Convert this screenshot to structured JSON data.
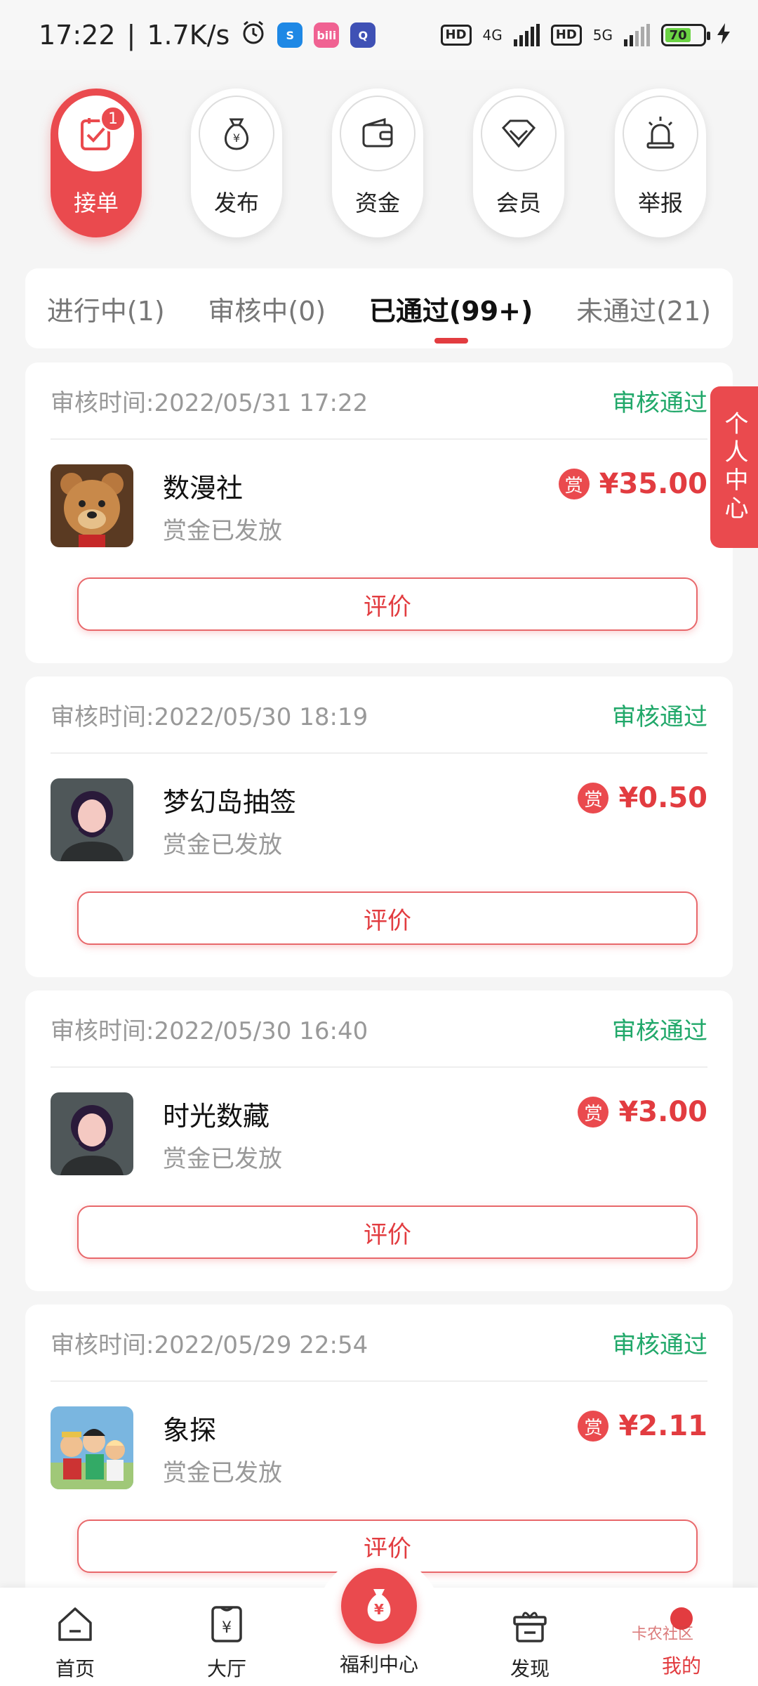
{
  "status_bar": {
    "time": "17:22",
    "speed": "1.7K/s",
    "network1": "4G",
    "network2": "5G",
    "hd1": "HD",
    "hd2": "HD",
    "battery": "70",
    "apps": [
      "alarm-icon",
      "shazam-icon",
      "bilibili-icon",
      "qq-icon"
    ]
  },
  "top_nav": [
    {
      "label": "接单",
      "icon": "task-check-icon",
      "badge": "1",
      "active": true
    },
    {
      "label": "发布",
      "icon": "money-bag-icon"
    },
    {
      "label": "资金",
      "icon": "wallet-icon"
    },
    {
      "label": "会员",
      "icon": "diamond-icon"
    },
    {
      "label": "举报",
      "icon": "alarm-light-icon"
    }
  ],
  "tabs": [
    {
      "label": "进行中(1)"
    },
    {
      "label": "审核中(0)"
    },
    {
      "label": "已通过(99+)",
      "active": true
    },
    {
      "label": "未通过(21)"
    }
  ],
  "side_button": {
    "label": "个人中心"
  },
  "orders": [
    {
      "time": "审核时间:2022/05/31 17:22",
      "status": "审核通过",
      "name": "数漫社",
      "sub": "赏金已发放",
      "reward_icon": "赏",
      "amount": "¥35.00",
      "button": "评价",
      "thumb": "teddy-bear-avatar"
    },
    {
      "time": "审核时间:2022/05/30 18:19",
      "status": "审核通过",
      "name": "梦幻岛抽签",
      "sub": "赏金已发放",
      "reward_icon": "赏",
      "amount": "¥0.50",
      "button": "评价",
      "thumb": "default-person-avatar"
    },
    {
      "time": "审核时间:2022/05/30 16:40",
      "status": "审核通过",
      "name": "时光数藏",
      "sub": "赏金已发放",
      "reward_icon": "赏",
      "amount": "¥3.00",
      "button": "评价",
      "thumb": "default-person-avatar"
    },
    {
      "time": "审核时间:2022/05/29 22:54",
      "status": "审核通过",
      "name": "象探",
      "sub": "赏金已发放",
      "reward_icon": "赏",
      "amount": "¥2.11",
      "button": "评价",
      "thumb": "anime-group-avatar"
    }
  ],
  "bottom_nav": [
    {
      "label": "首页",
      "icon": "home-icon"
    },
    {
      "label": "大厅",
      "icon": "hall-icon"
    },
    {
      "label": "福利中心",
      "icon": "money-bag-icon"
    },
    {
      "label": "发现",
      "icon": "gift-box-icon"
    },
    {
      "label": "我的",
      "icon": "profile-dot-icon",
      "active": true
    }
  ],
  "watermark": "卡农社区",
  "colors": {
    "accent": "#ea4a4e",
    "success": "#21a86a",
    "muted": "#999999"
  }
}
